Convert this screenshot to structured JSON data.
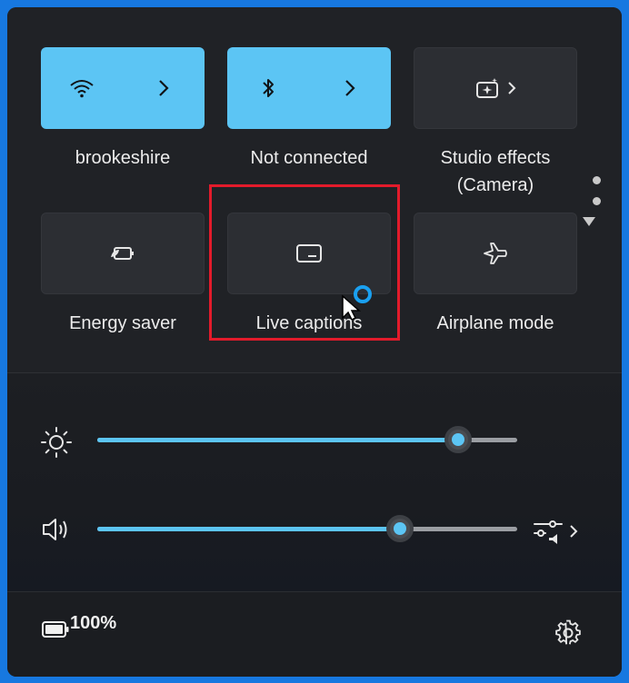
{
  "tiles": [
    {
      "label": "brookeshire",
      "icon": "wifi-icon",
      "state": "on",
      "has_chevron": true
    },
    {
      "label": "Not connected",
      "icon": "bluetooth-icon",
      "state": "on",
      "has_chevron": true
    },
    {
      "label_line1": "Studio effects",
      "label_line2": "(Camera)",
      "icon": "studio-effects-icon",
      "state": "off",
      "has_chevron": true
    },
    {
      "label": "Energy saver",
      "icon": "energy-saver-icon",
      "state": "off"
    },
    {
      "label": "Live captions",
      "icon": "captions-icon",
      "state": "off"
    },
    {
      "label": "Airplane mode",
      "icon": "airplane-icon",
      "state": "off"
    }
  ],
  "sliders": {
    "brightness": {
      "icon": "brightness-icon",
      "value": 0.86
    },
    "volume": {
      "icon": "speaker-icon",
      "value": 0.72,
      "extra_icon": "audio-output-icon"
    }
  },
  "footer": {
    "battery_percent": "100%",
    "battery_icon": "battery-icon",
    "settings_icon": "gear-icon"
  },
  "colors": {
    "accent": "#5cc5f4",
    "panel": "#202226",
    "tile_off": "#2c2e33",
    "highlight": "#e21b2b",
    "outer_frame": "#1778e0"
  }
}
